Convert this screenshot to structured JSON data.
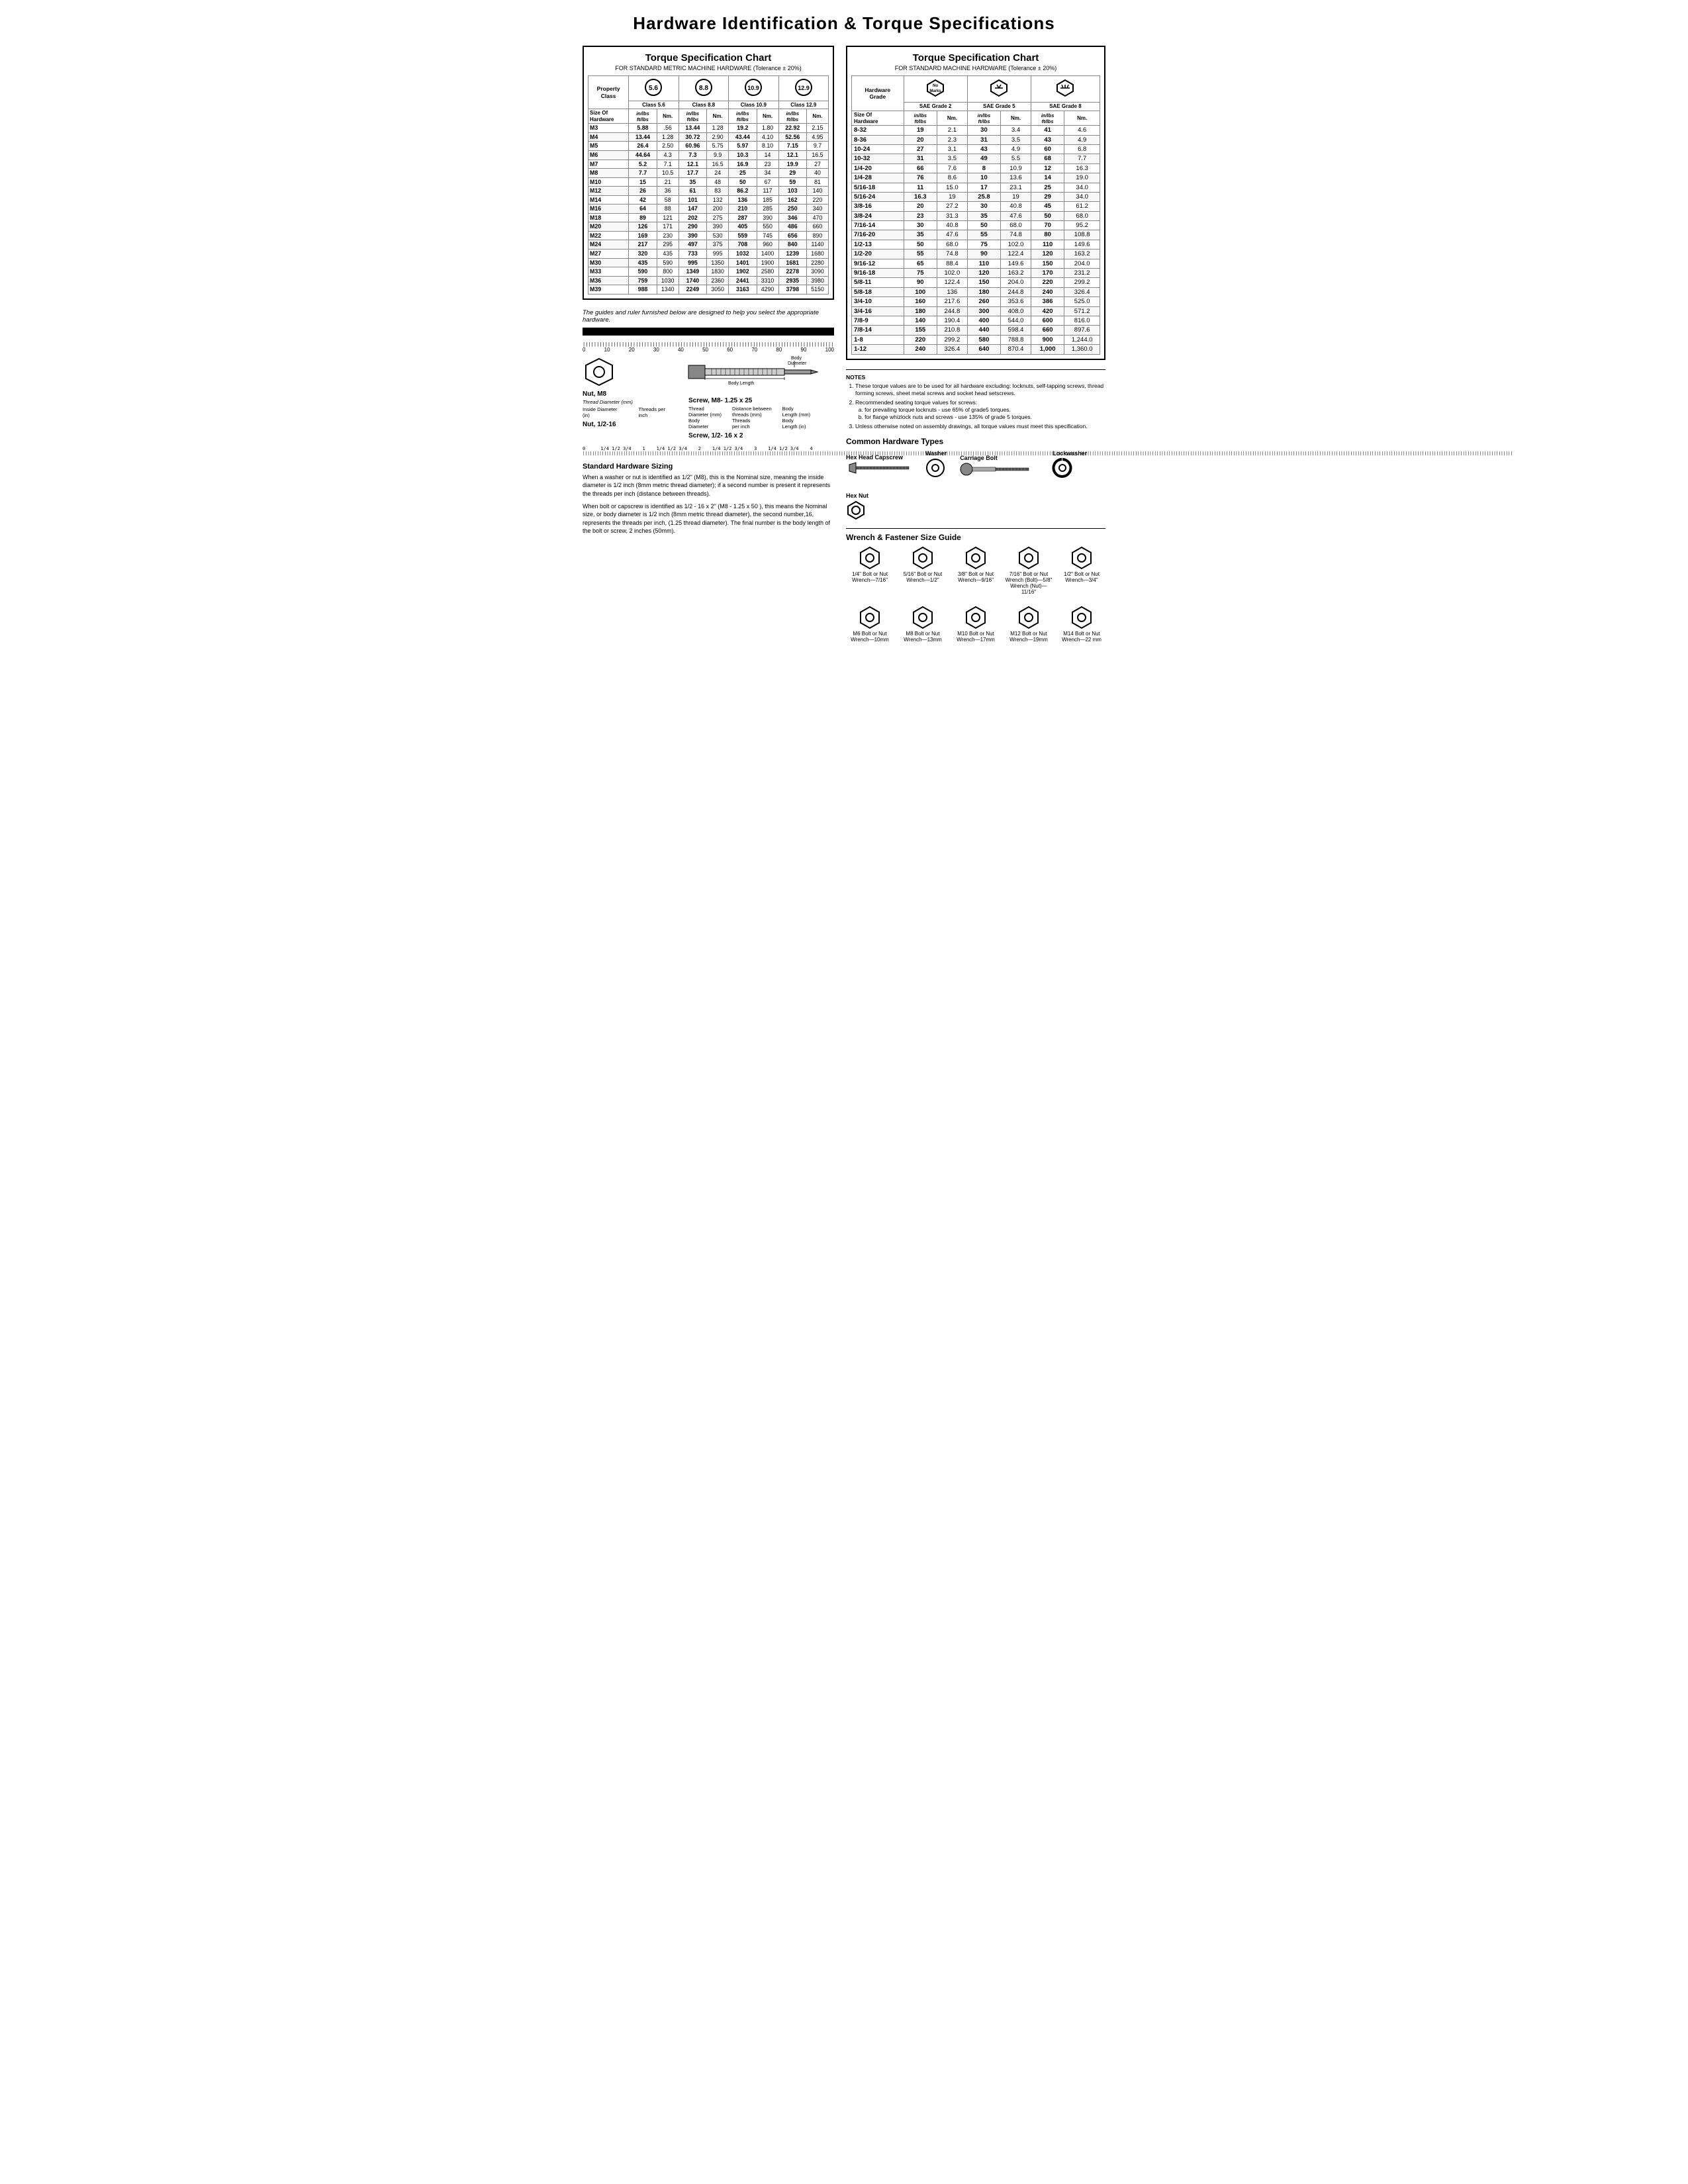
{
  "title": "Hardware Identification  &  Torque Specifications",
  "left_chart": {
    "title": "Torque Specification Chart",
    "subtitle": "FOR STANDARD METRIC MACHINE HARDWARE (Tolerance ± 20%)",
    "property_class_label": "Property Class",
    "classes": [
      "5.6",
      "8.8",
      "10.9",
      "12.9"
    ],
    "class_labels": [
      "Class 5.6",
      "Class 8.8",
      "Class 10.9",
      "Class 12.9"
    ],
    "col_headers": [
      "Size Of Hardware",
      "in/lbs ft/lbs",
      "Nm.",
      "in/lbs ft/lbs",
      "Nm.",
      "in/lbs ft/lbs",
      "Nm.",
      "in/lbs ft/lbs",
      "Nm."
    ],
    "rows": [
      [
        "M3",
        "5.88",
        ".56",
        "13.44",
        "1.28",
        "19.2",
        "1.80",
        "22.92",
        "2.15"
      ],
      [
        "M4",
        "13.44",
        "1.28",
        "30.72",
        "2.90",
        "43.44",
        "4.10",
        "52.56",
        "4.95"
      ],
      [
        "M5",
        "26.4",
        "2.50",
        "60.96",
        "5.75",
        "5.97",
        "8.10",
        "7.15",
        "9.7"
      ],
      [
        "M6",
        "44.64",
        "4.3",
        "7.3",
        "9.9",
        "10.3",
        "14",
        "12.1",
        "16.5"
      ],
      [
        "M7",
        "5.2",
        "7.1",
        "12.1",
        "16.5",
        "16.9",
        "23",
        "19.9",
        "27"
      ],
      [
        "M8",
        "7.7",
        "10.5",
        "17.7",
        "24",
        "25",
        "34",
        "29",
        "40"
      ],
      [
        "M10",
        "15",
        "21",
        "35",
        "48",
        "50",
        "67",
        "59",
        "81"
      ],
      [
        "M12",
        "26",
        "36",
        "61",
        "83",
        "86.2",
        "117",
        "103",
        "140"
      ],
      [
        "M14",
        "42",
        "58",
        "101",
        "132",
        "136",
        "185",
        "162",
        "220"
      ],
      [
        "M16",
        "64",
        "88",
        "147",
        "200",
        "210",
        "285",
        "250",
        "340"
      ],
      [
        "M18",
        "89",
        "121",
        "202",
        "275",
        "287",
        "390",
        "346",
        "470"
      ],
      [
        "M20",
        "126",
        "171",
        "290",
        "390",
        "405",
        "550",
        "486",
        "660"
      ],
      [
        "M22",
        "169",
        "230",
        "390",
        "530",
        "559",
        "745",
        "656",
        "890"
      ],
      [
        "M24",
        "217",
        "295",
        "497",
        "375",
        "708",
        "960",
        "840",
        "1140"
      ],
      [
        "M27",
        "320",
        "435",
        "733",
        "995",
        "1032",
        "1400",
        "1239",
        "1680"
      ],
      [
        "M30",
        "435",
        "590",
        "995",
        "1350",
        "1401",
        "1900",
        "1681",
        "2280"
      ],
      [
        "M33",
        "590",
        "800",
        "1349",
        "1830",
        "1902",
        "2580",
        "2278",
        "3090"
      ],
      [
        "M36",
        "759",
        "1030",
        "1740",
        "2360",
        "2441",
        "3310",
        "2935",
        "3980"
      ],
      [
        "M39",
        "988",
        "1340",
        "2249",
        "3050",
        "3163",
        "4290",
        "3798",
        "5150"
      ]
    ]
  },
  "right_chart": {
    "title": "Torque Specification Chart",
    "subtitle": "FOR STANDARD MACHINE HARDWARE (Tolerance ± 20%)",
    "hardware_grade_label": "Hardware Grade",
    "no_marks_label": "No Marks",
    "grades": [
      "SAE Grade 2",
      "SAE Grade 5",
      "SAE Grade 8"
    ],
    "col_headers": [
      "Size Of Hardware",
      "in/lbs ft/lbs",
      "Nm.",
      "in/lbs ft/lbs",
      "Nm.",
      "in/lbs ft/lbs",
      "Nm."
    ],
    "rows": [
      [
        "8-32",
        "19",
        "2.1",
        "30",
        "3.4",
        "41",
        "4.6"
      ],
      [
        "8-36",
        "20",
        "2.3",
        "31",
        "3.5",
        "43",
        "4.9"
      ],
      [
        "10-24",
        "27",
        "3.1",
        "43",
        "4.9",
        "60",
        "6.8"
      ],
      [
        "10-32",
        "31",
        "3.5",
        "49",
        "5.5",
        "68",
        "7.7"
      ],
      [
        "1/4-20",
        "66",
        "7.6",
        "8",
        "10.9",
        "12",
        "16.3"
      ],
      [
        "1/4-28",
        "76",
        "8.6",
        "10",
        "13.6",
        "14",
        "19.0"
      ],
      [
        "5/16-18",
        "11",
        "15.0",
        "17",
        "23.1",
        "25",
        "34.0"
      ],
      [
        "5/16-24",
        "16.3",
        "19",
        "25.8",
        "19",
        "29",
        "34.0"
      ],
      [
        "3/8-16",
        "20",
        "27.2",
        "30",
        "40.8",
        "45",
        "61.2"
      ],
      [
        "3/8-24",
        "23",
        "31.3",
        "35",
        "47.6",
        "50",
        "68.0"
      ],
      [
        "7/16-14",
        "30",
        "40.8",
        "50",
        "68.0",
        "70",
        "95.2"
      ],
      [
        "7/16-20",
        "35",
        "47.6",
        "55",
        "74.8",
        "80",
        "108.8"
      ],
      [
        "1/2-13",
        "50",
        "68.0",
        "75",
        "102.0",
        "110",
        "149.6"
      ],
      [
        "1/2-20",
        "55",
        "74.8",
        "90",
        "122.4",
        "120",
        "163.2"
      ],
      [
        "9/16-12",
        "65",
        "88.4",
        "110",
        "149.6",
        "150",
        "204.0"
      ],
      [
        "9/16-18",
        "75",
        "102.0",
        "120",
        "163.2",
        "170",
        "231.2"
      ],
      [
        "5/8-11",
        "90",
        "122.4",
        "150",
        "204.0",
        "220",
        "299.2"
      ],
      [
        "5/8-18",
        "100",
        "136",
        "180",
        "244.8",
        "240",
        "326.4"
      ],
      [
        "3/4-10",
        "160",
        "217.6",
        "260",
        "353.6",
        "386",
        "525.0"
      ],
      [
        "3/4-16",
        "180",
        "244.8",
        "300",
        "408.0",
        "420",
        "571.2"
      ],
      [
        "7/8-9",
        "140",
        "190.4",
        "400",
        "544.0",
        "600",
        "816.0"
      ],
      [
        "7/8-14",
        "155",
        "210.8",
        "440",
        "598.4",
        "660",
        "897.6"
      ],
      [
        "1-8",
        "220",
        "299.2",
        "580",
        "788.8",
        "900",
        "1,244.0"
      ],
      [
        "1-12",
        "240",
        "326.4",
        "640",
        "870.4",
        "1,000",
        "1,360.0"
      ]
    ],
    "notes_title": "NOTES",
    "notes": [
      "These torque values are to be used for all hardware excluding: locknuts, self-tapping screws, thread forming screws, sheet metal screws and socket head setscrews.",
      "Recommended seating torque values for screws:\na. for prevailing torque locknuts - use 65% of grade5 torques.\nb. for flange whizlock nuts and screws - use 135% of grade 5 torques.",
      "Unless otherwise noted on assembly drawings, all torque values must meet this specification."
    ]
  },
  "guides": {
    "italic_text": "The guides and ruler furnished below are designed to help you select the appropriate hardware.",
    "ruler_numbers": [
      "0",
      "10",
      "20",
      "30",
      "40",
      "50",
      "60",
      "70",
      "80",
      "90",
      "100"
    ],
    "nut_label": "Nut, M8",
    "nut_sub1": "Thread Diameter (mm)",
    "nut_sub2": "Inside Diameter (in)",
    "nut_sub3": "Threads per inch",
    "nut_label2": "Nut, 1/2-16",
    "screw_label": "Screw, M8- 1.25 x 25",
    "screw_sub1": "Thread Diameter (mm)",
    "screw_sub2": "Body Diameter",
    "screw_sub3": "Distance between threads (mm)",
    "screw_sub4": "Threads per inch",
    "screw_sub5": "Body Length (mm)",
    "screw_sub6": "Body",
    "screw_label2": "Screw, 1/2- 16 x 2",
    "body_diameter_label": "Body Diameter",
    "body_length_label": "Body Length"
  },
  "std_hw": {
    "title": "Standard Hardware Sizing",
    "para1": "When a washer or nut is identified as 1/2\" (M8), this is the Nominal size, meaning the inside diameter is 1/2 inch (8mm metric thread diameter); if a second number is present it represents the threads per inch (distance between threads).",
    "para2": "When bolt or capscrew is identified as 1/2 - 16 x 2\" (M8 - 1.25 x 50 ), this means the Nominal size, or body diameter is 1/2 inch (8mm metric thread diameter), the second number,16, represents the threads per inch, (1.25 thread diameter). The final number is the body length of the bolt or screw, 2 inches (50mm)."
  },
  "common_hw": {
    "title": "Common Hardware Types",
    "items": [
      {
        "name": "Hex Head Capscrew",
        "position": "left"
      },
      {
        "name": "Washer",
        "position": "right"
      },
      {
        "name": "Carriage Bolt",
        "position": "left"
      },
      {
        "name": "Lockwasher",
        "position": "right"
      },
      {
        "name": "",
        "position": "left"
      },
      {
        "name": "Hex Nut",
        "position": "right"
      }
    ]
  },
  "wrench_guide": {
    "title": "Wrench & Fastener Size Guide",
    "items": [
      {
        "bolt": "1/4\" Bolt or Nut",
        "wrench": "Wrench—7/16\""
      },
      {
        "bolt": "5/16\" Bolt or Nut",
        "wrench": "Wrench—1/2\""
      },
      {
        "bolt": "3/8\" Bolt or Nut",
        "wrench": "Wrench—9/16\""
      },
      {
        "bolt": "7/16\" Bolt or Nut",
        "wrench": "Wrench (Bolt)—5/8\" Wrench (Nut)—11/16\""
      },
      {
        "bolt": "1/2\" Bolt or Nut",
        "wrench": "Wrench—3/4\""
      },
      {
        "bolt": "M6 Bolt or Nut",
        "wrench": "Wrench—10mm"
      },
      {
        "bolt": "M8 Bolt or Nut",
        "wrench": "Wrench—13mm"
      },
      {
        "bolt": "M10 Bolt or Nut",
        "wrench": "Wrench—17mm"
      },
      {
        "bolt": "M12 Bolt or Nut",
        "wrench": "Wrench—19mm"
      },
      {
        "bolt": "M14 Bolt or Nut",
        "wrench": "Wrench—22 mm"
      }
    ]
  }
}
